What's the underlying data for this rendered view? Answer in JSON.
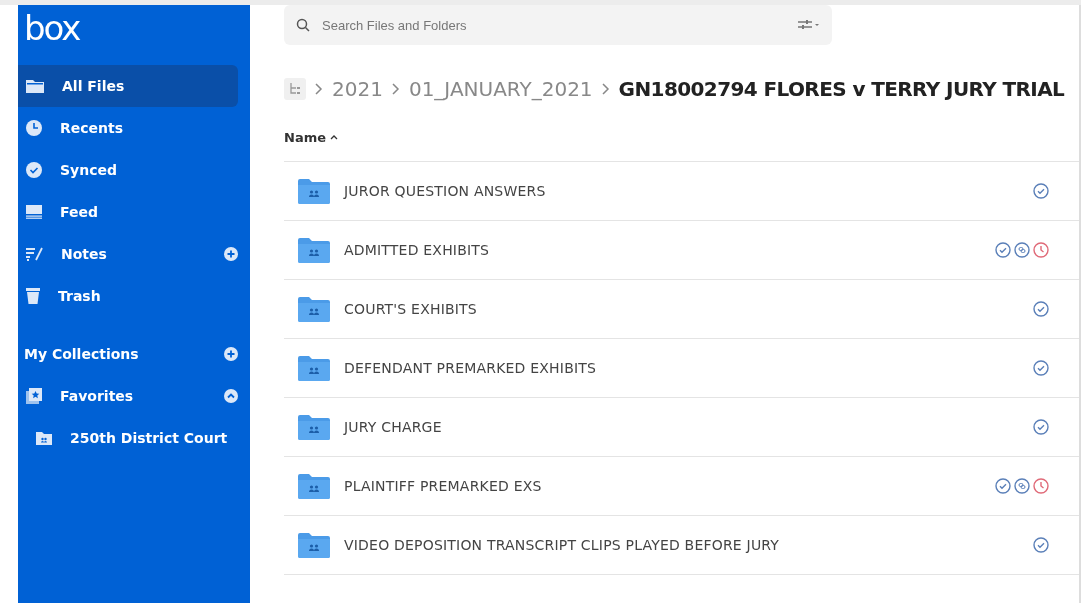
{
  "logo": "box",
  "sidebar": {
    "items": [
      {
        "label": "All Files",
        "selected": true
      },
      {
        "label": "Recents",
        "selected": false
      },
      {
        "label": "Synced",
        "selected": false
      },
      {
        "label": "Feed",
        "selected": false
      },
      {
        "label": "Notes",
        "selected": false,
        "add": true
      },
      {
        "label": "Trash",
        "selected": false
      }
    ],
    "collections": {
      "label": "My Collections",
      "add": true
    },
    "favorites": {
      "label": "Favorites",
      "expanded": true,
      "children": [
        {
          "label": "250th District Court"
        }
      ]
    }
  },
  "search": {
    "placeholder": "Search Files and Folders"
  },
  "breadcrumb": [
    "2021",
    "01_JANUARY_2021",
    "GN18002794 FLORES v TERRY JURY TRIAL"
  ],
  "table": {
    "columns": [
      {
        "label": "Name",
        "sort_ascending": true
      }
    ],
    "rows": [
      {
        "name": "JUROR QUESTION ANSWERS",
        "synced": true,
        "shared_link": false,
        "expiring": false
      },
      {
        "name": "ADMITTED EXHIBITS",
        "synced": true,
        "shared_link": true,
        "expiring": true
      },
      {
        "name": "COURT'S EXHIBITS",
        "synced": true,
        "shared_link": false,
        "expiring": false
      },
      {
        "name": "DEFENDANT PREMARKED EXHIBITS",
        "synced": true,
        "shared_link": false,
        "expiring": false
      },
      {
        "name": "JURY CHARGE",
        "synced": true,
        "shared_link": false,
        "expiring": false
      },
      {
        "name": "PLAINTIFF PREMARKED EXS",
        "synced": true,
        "shared_link": true,
        "expiring": true
      },
      {
        "name": "VIDEO DEPOSITION TRANSCRIPT CLIPS PLAYED BEFORE JURY",
        "synced": true,
        "shared_link": false,
        "expiring": false
      }
    ]
  }
}
